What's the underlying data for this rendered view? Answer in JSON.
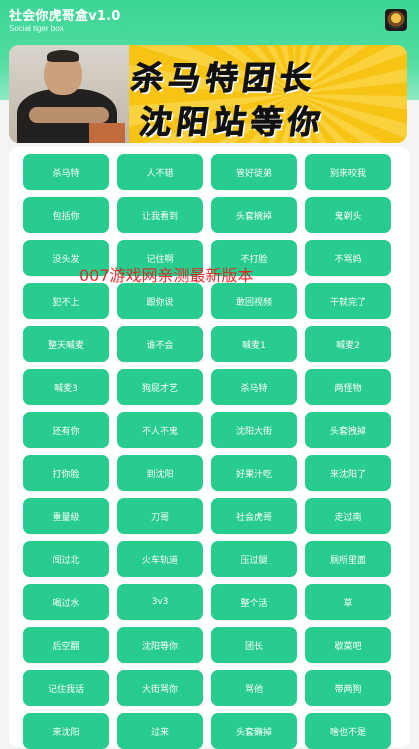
{
  "header": {
    "title": "社会你虎哥盒v1.0",
    "subtitle": "Social tiger box",
    "avatar_icon": "app-avatar-icon",
    "accent": "#3cd596"
  },
  "banner": {
    "line1": "杀马特团长",
    "line2": "沈阳站等你"
  },
  "buttons": [
    "杀马特",
    "人不错",
    "管好徒弟",
    "别来咬我",
    "包括你",
    "让我看到",
    "头套摘掉",
    "鬼剃头",
    "没头发",
    "记住啊",
    "不打脸",
    "不骂妈",
    "犯不上",
    "跟你说",
    "敢回视频",
    "干就完了",
    "整天喊麦",
    "谁不会",
    "喊麦1",
    "喊麦2",
    "喊麦3",
    "狗屁才艺",
    "杀马特",
    "两怪物",
    "还有你",
    "不人不鬼",
    "沈阳大街",
    "头套拽掉",
    "打你脸",
    "到沈阳",
    "好果汁吃",
    "来沈阳了",
    "重量级",
    "刀哥",
    "社会虎哥",
    "走过南",
    "闯过北",
    "火车轨道",
    "压过腿",
    "厕所里面",
    "喝过水",
    "3v3",
    "整个活",
    "草",
    "后空翻",
    "沈阳等你",
    "团长",
    "歇菜吧",
    "记住我话",
    "大街骂你",
    "骂他",
    "带两狗",
    "来沈阳",
    "过来",
    "头套薅掉",
    "啥也不是"
  ],
  "watermark": "007游戏网亲测最新版本",
  "colors": {
    "button_bg": "#28cc8f",
    "button_text": "#ffffff",
    "watermark": "#ea1d1d"
  }
}
